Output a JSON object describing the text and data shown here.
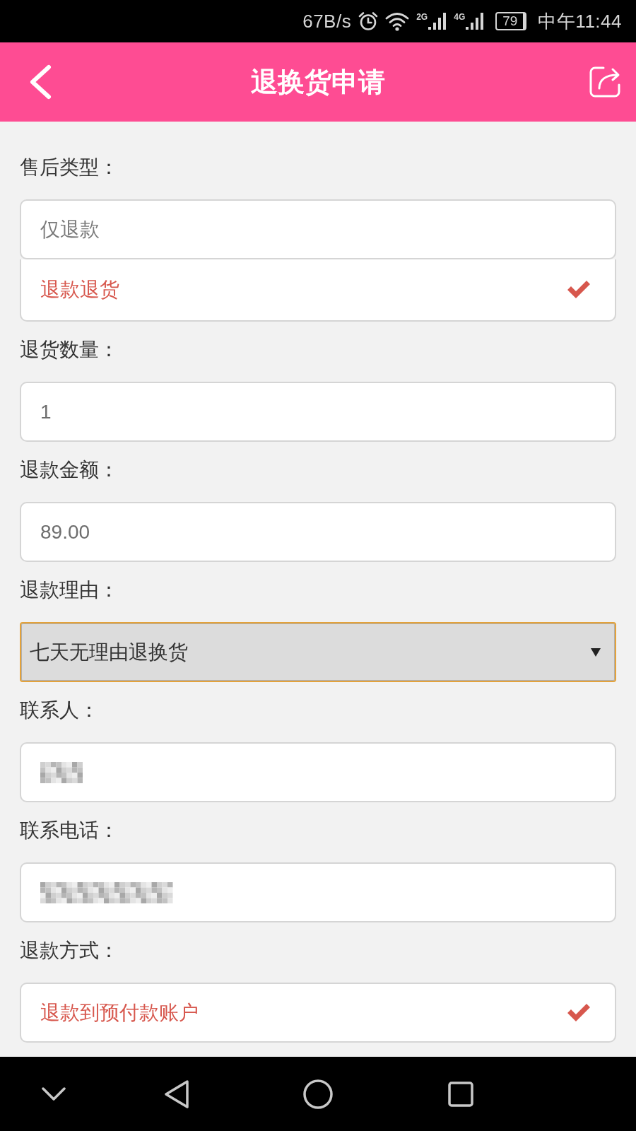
{
  "status_bar": {
    "network_speed": "67B/s",
    "signals": [
      {
        "label": "2G"
      },
      {
        "label": "4G"
      }
    ],
    "battery": "79",
    "time": "中午11:44"
  },
  "header": {
    "title": "退换货申请"
  },
  "form": [
    {
      "label": "售后类型：",
      "kind": "options",
      "focused": false,
      "options": [
        {
          "label": "仅退款",
          "selected": false
        },
        {
          "label": "退款退货",
          "selected": true
        }
      ]
    },
    {
      "label": "退货数量：",
      "kind": "input",
      "focused": false,
      "redacted": false,
      "value": "1"
    },
    {
      "label": "退款金额：",
      "kind": "input",
      "focused": false,
      "redacted": false,
      "value": "89.00"
    },
    {
      "label": "退款理由：",
      "kind": "select",
      "focused": true,
      "value": "七天无理由退换货"
    },
    {
      "label": "联系人：",
      "kind": "input",
      "focused": false,
      "redacted": true
    },
    {
      "label": "联系电话：",
      "kind": "input",
      "focused": false,
      "redacted": true
    },
    {
      "label": "退款方式：",
      "kind": "options",
      "focused": false,
      "options": [
        {
          "label": "退款到预付款账户",
          "selected": true
        }
      ]
    }
  ]
}
